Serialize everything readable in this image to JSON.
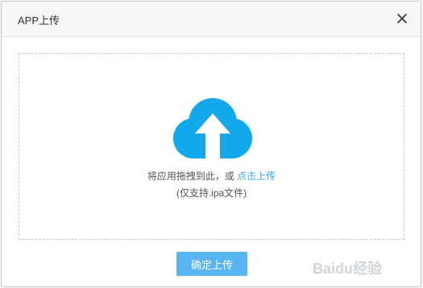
{
  "dialog": {
    "title": "APP上传",
    "close_icon": "close-icon"
  },
  "dropzone": {
    "icon": "cloud-upload-icon",
    "icon_color": "#13a8ea",
    "hint_text": "将应用拖拽到此，或 ",
    "hint_link": "点击上传",
    "hint_link_color": "#3aa7e8",
    "sub_text": "(仅支持.ipa文件)"
  },
  "footer": {
    "confirm_label": "确定上传",
    "confirm_color": "#59b5f2"
  },
  "watermark": {
    "text": "Baidu经验",
    "icon": "baidu-paw-logo-icon"
  }
}
